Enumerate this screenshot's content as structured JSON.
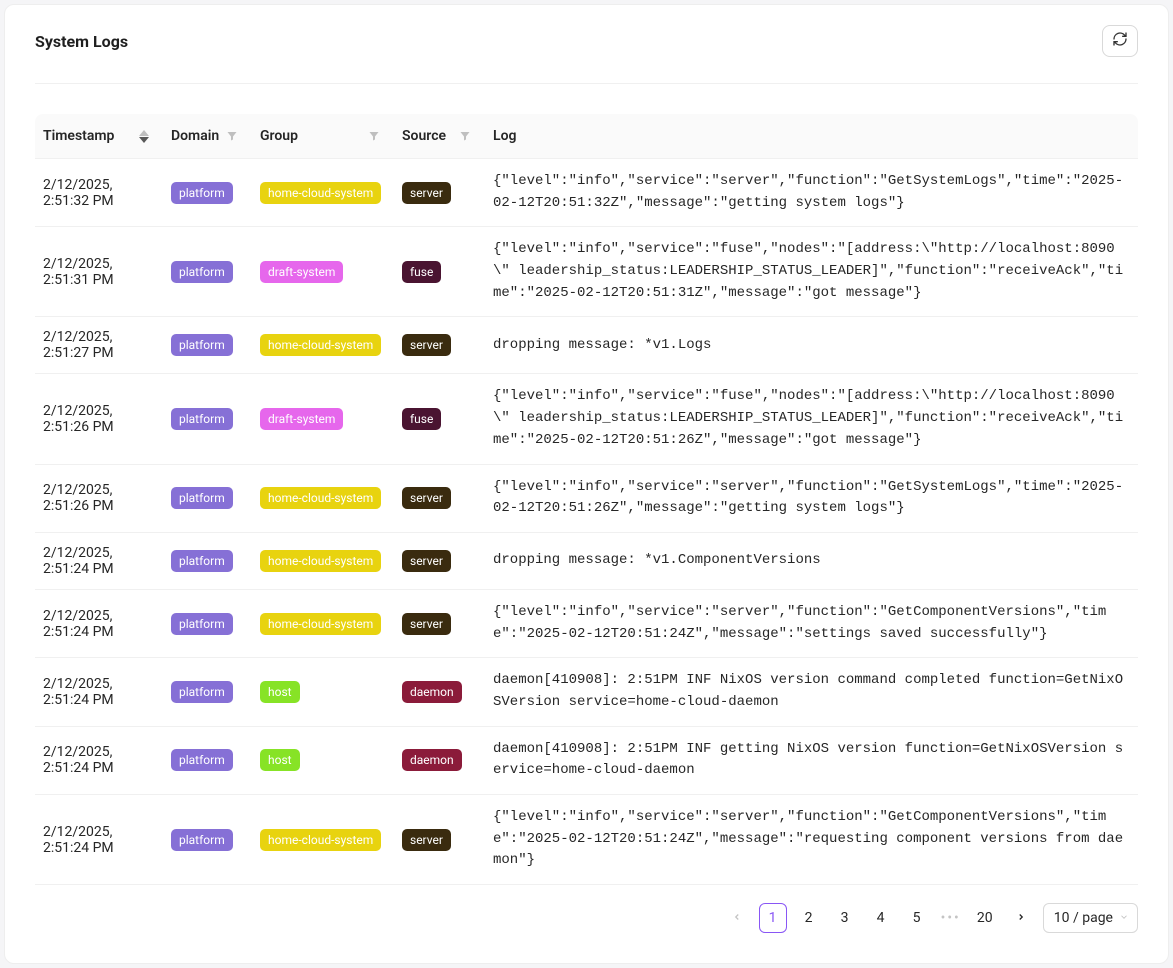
{
  "title": "System Logs",
  "columns": {
    "timestamp": "Timestamp",
    "domain": "Domain",
    "group": "Group",
    "source": "Source",
    "log": "Log"
  },
  "tags": {
    "platform": {
      "label": "platform",
      "bg": "#8670d6"
    },
    "home-cloud-system": {
      "label": "home-cloud-system",
      "bg": "#e8d30f"
    },
    "draft-system": {
      "label": "draft-system",
      "bg": "#e667ec"
    },
    "host": {
      "label": "host",
      "bg": "#87e326"
    },
    "server": {
      "label": "server",
      "bg": "#3a2b0f"
    },
    "fuse": {
      "label": "fuse",
      "bg": "#4a1431"
    },
    "daemon": {
      "label": "daemon",
      "bg": "#8b1b3a"
    }
  },
  "rows": [
    {
      "timestamp": "2/12/2025, 2:51:32 PM",
      "domain": "platform",
      "group": "home-cloud-system",
      "source": "server",
      "log": "{\"level\":\"info\",\"service\":\"server\",\"function\":\"GetSystemLogs\",\"time\":\"2025-02-12T20:51:32Z\",\"message\":\"getting system logs\"}"
    },
    {
      "timestamp": "2/12/2025, 2:51:31 PM",
      "domain": "platform",
      "group": "draft-system",
      "source": "fuse",
      "log": "{\"level\":\"info\",\"service\":\"fuse\",\"nodes\":\"[address:\\\"http://localhost:8090\\\" leadership_status:LEADERSHIP_STATUS_LEADER]\",\"function\":\"receiveAck\",\"time\":\"2025-02-12T20:51:31Z\",\"message\":\"got message\"}"
    },
    {
      "timestamp": "2/12/2025, 2:51:27 PM",
      "domain": "platform",
      "group": "home-cloud-system",
      "source": "server",
      "log": "dropping message: *v1.Logs"
    },
    {
      "timestamp": "2/12/2025, 2:51:26 PM",
      "domain": "platform",
      "group": "draft-system",
      "source": "fuse",
      "log": "{\"level\":\"info\",\"service\":\"fuse\",\"nodes\":\"[address:\\\"http://localhost:8090\\\" leadership_status:LEADERSHIP_STATUS_LEADER]\",\"function\":\"receiveAck\",\"time\":\"2025-02-12T20:51:26Z\",\"message\":\"got message\"}"
    },
    {
      "timestamp": "2/12/2025, 2:51:26 PM",
      "domain": "platform",
      "group": "home-cloud-system",
      "source": "server",
      "log": "{\"level\":\"info\",\"service\":\"server\",\"function\":\"GetSystemLogs\",\"time\":\"2025-02-12T20:51:26Z\",\"message\":\"getting system logs\"}"
    },
    {
      "timestamp": "2/12/2025, 2:51:24 PM",
      "domain": "platform",
      "group": "home-cloud-system",
      "source": "server",
      "log": "dropping message: *v1.ComponentVersions"
    },
    {
      "timestamp": "2/12/2025, 2:51:24 PM",
      "domain": "platform",
      "group": "home-cloud-system",
      "source": "server",
      "log": "{\"level\":\"info\",\"service\":\"server\",\"function\":\"GetComponentVersions\",\"time\":\"2025-02-12T20:51:24Z\",\"message\":\"settings saved successfully\"}"
    },
    {
      "timestamp": "2/12/2025, 2:51:24 PM",
      "domain": "platform",
      "group": "host",
      "source": "daemon",
      "log": "daemon[410908]: 2:51PM INF NixOS version command completed function=GetNixOSVersion service=home-cloud-daemon"
    },
    {
      "timestamp": "2/12/2025, 2:51:24 PM",
      "domain": "platform",
      "group": "host",
      "source": "daemon",
      "log": "daemon[410908]: 2:51PM INF getting NixOS version function=GetNixOSVersion service=home-cloud-daemon"
    },
    {
      "timestamp": "2/12/2025, 2:51:24 PM",
      "domain": "platform",
      "group": "home-cloud-system",
      "source": "server",
      "log": "{\"level\":\"info\",\"service\":\"server\",\"function\":\"GetComponentVersions\",\"time\":\"2025-02-12T20:51:24Z\",\"message\":\"requesting component versions from daemon\"}"
    }
  ],
  "pagination": {
    "pages_shown": [
      "1",
      "2",
      "3",
      "4",
      "5"
    ],
    "last_page": "20",
    "active": "1",
    "page_size_label": "10 / page"
  }
}
